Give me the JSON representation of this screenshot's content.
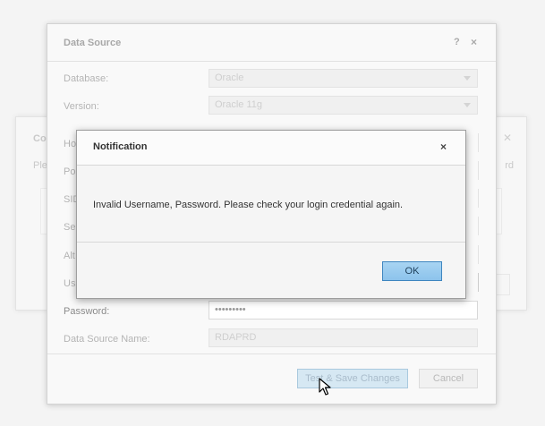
{
  "back_dialog": {
    "title": "Co",
    "subtitle": "Ple",
    "subtitle_right": "rd"
  },
  "data_source": {
    "title": "Data Source",
    "help_icon": "?",
    "close_icon": "×",
    "fields": {
      "database": {
        "label": "Database:",
        "value": "Oracle"
      },
      "version": {
        "label": "Version:",
        "value": "Oracle 11g"
      },
      "host": {
        "label": "Ho"
      },
      "port": {
        "label": "Po"
      },
      "sid": {
        "label": "SID"
      },
      "service": {
        "label": "Se"
      },
      "alt": {
        "label": "Alt"
      },
      "username": {
        "label": "Us"
      },
      "password": {
        "label": "Password:",
        "value": "•••••••••"
      },
      "datasource_name": {
        "label": "Data Source Name:",
        "value": "RDAPRD"
      }
    },
    "buttons": {
      "test_save": "Test & Save Changes",
      "cancel": "Cancel"
    }
  },
  "notification": {
    "title": "Notification",
    "close_icon": "×",
    "message": "Invalid Username, Password. Please check your login credential again.",
    "ok_label": "OK"
  },
  "colors": {
    "ok_button": "#8cc3ec",
    "ok_border": "#3e86c0",
    "dialog_bg": "#f9f9f9"
  }
}
